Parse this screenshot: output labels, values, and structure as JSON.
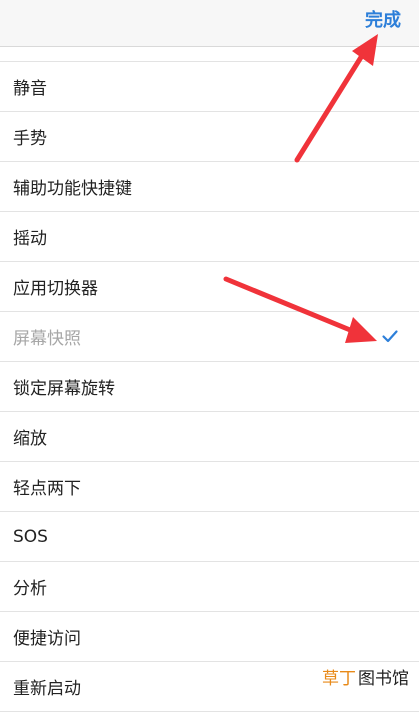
{
  "nav": {
    "done_label": "完成"
  },
  "menu": {
    "items": [
      {
        "label": "静音",
        "state": "normal"
      },
      {
        "label": "手势",
        "state": "normal"
      },
      {
        "label": "辅助功能快捷键",
        "state": "normal"
      },
      {
        "label": "摇动",
        "state": "normal"
      },
      {
        "label": "应用切换器",
        "state": "normal"
      },
      {
        "label": "屏幕快照",
        "state": "selected"
      },
      {
        "label": "锁定屏幕旋转",
        "state": "normal"
      },
      {
        "label": "缩放",
        "state": "normal"
      },
      {
        "label": "轻点两下",
        "state": "normal"
      },
      {
        "label": "SOS",
        "state": "normal"
      },
      {
        "label": "分析",
        "state": "normal"
      },
      {
        "label": "便捷访问",
        "state": "normal"
      },
      {
        "label": "重新启动",
        "state": "normal"
      }
    ]
  },
  "watermark": {
    "brand": "草丁",
    "name": "图书馆"
  },
  "colors": {
    "accent": "#2d7fd9",
    "annotation_arrow": "#f0333a",
    "watermark_brand": "#e88a19"
  },
  "icons": {
    "selected_mark": "checkmark-icon"
  }
}
